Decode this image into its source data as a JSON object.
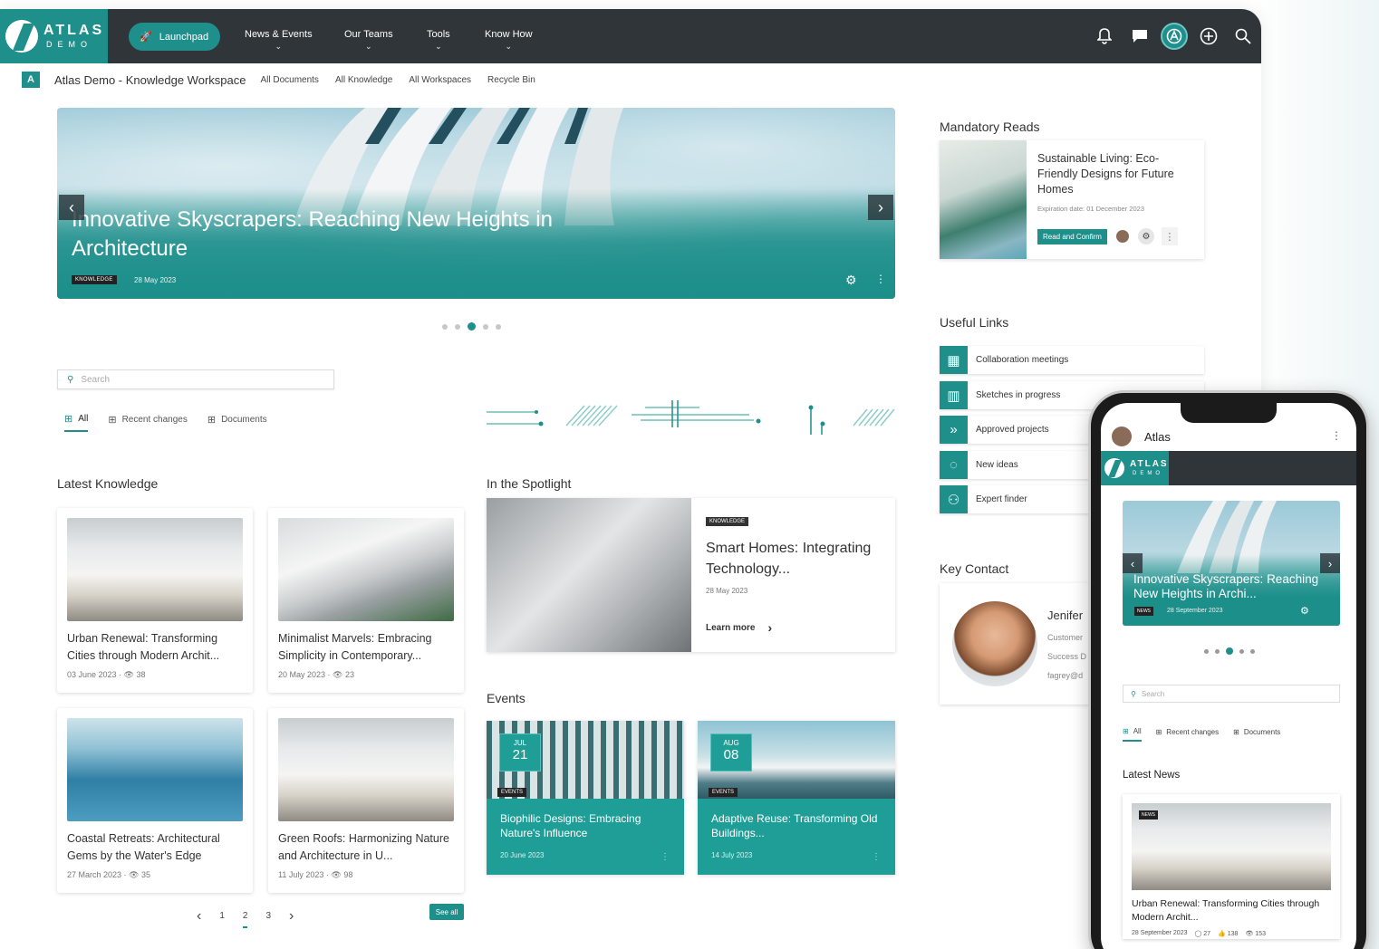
{
  "brand": {
    "name": "ATLAS",
    "sub": "DEMO",
    "accent": "#1f8f8c",
    "topbar": "#2f3538"
  },
  "nav": {
    "launchpad": "Launchpad",
    "items": [
      {
        "label": "News & Events"
      },
      {
        "label": "Our Teams"
      },
      {
        "label": "Tools"
      },
      {
        "label": "Know How"
      }
    ],
    "icons": [
      "bell-icon",
      "chat-icon",
      "atlas-app-icon",
      "add-icon",
      "search-icon"
    ]
  },
  "subnav": {
    "badge": "A",
    "site": "Atlas Demo - Knowledge Workspace",
    "links": [
      "All Documents",
      "All Knowledge",
      "All Workspaces",
      "Recycle Bin"
    ]
  },
  "hero": {
    "title": "Innovative Skyscrapers: Reaching New Heights in Architecture",
    "tag": "KNOWLEDGE",
    "date": "28 May 2023",
    "prev": "‹",
    "next": "›"
  },
  "search": {
    "placeholder": "Search"
  },
  "tabs": [
    "All",
    "Recent changes",
    "Documents"
  ],
  "latest": {
    "heading": "Latest Knowledge",
    "cards": [
      {
        "title": "Urban Renewal: Transforming Cities through Modern Archit...",
        "date": "03 June 2023",
        "views": "38"
      },
      {
        "title": "Minimalist Marvels: Embracing Simplicity in Contemporary...",
        "date": "20 May 2023",
        "views": "23"
      },
      {
        "title": "Coastal Retreats: Architectural Gems by the Water's Edge",
        "date": "27 March 2023",
        "views": "35"
      },
      {
        "title": "Green Roofs: Harmonizing Nature and Architecture in U...",
        "date": "11 July 2023",
        "views": "98"
      }
    ]
  },
  "spotlight": {
    "heading": "In the Spotlight",
    "tag": "KNOWLEDGE",
    "title": "Smart Homes: Integrating Technology...",
    "date": "28 May 2023",
    "more": "Learn more"
  },
  "events": {
    "heading": "Events",
    "items": [
      {
        "month": "JUL",
        "day": "21",
        "tag": "EVENTS",
        "title": "Biophilic Designs: Embracing Nature's Influence",
        "date": "20 June 2023"
      },
      {
        "month": "AUG",
        "day": "08",
        "tag": "EVENTS",
        "title": "Adaptive Reuse: Transforming Old Buildings...",
        "date": "14 July 2023"
      }
    ]
  },
  "pager": {
    "prev": "‹",
    "pages": [
      "1",
      "2",
      "3"
    ],
    "current": "2",
    "next": "›",
    "see_all": "See all"
  },
  "mandatory": {
    "heading": "Mandatory Reads",
    "title": "Sustainable Living: Eco-Friendly Designs for Future Homes",
    "expiry": "Expiration date: 01 December 2023",
    "button": "Read and Confirm"
  },
  "useful": {
    "heading": "Useful Links",
    "links": [
      {
        "label": "Collaboration meetings",
        "icon": "calendar-icon"
      },
      {
        "label": "Sketches in progress",
        "icon": "books-icon"
      },
      {
        "label": "Approved projects",
        "icon": "forward-calendar-icon"
      },
      {
        "label": "New ideas",
        "icon": "lightbulb-icon"
      },
      {
        "label": "Expert finder",
        "icon": "people-search-icon"
      }
    ]
  },
  "contact": {
    "heading": "Key Contact",
    "name": "Jenifer",
    "line1": "Customer",
    "line2": "Success D",
    "line3": "fagrey@d"
  },
  "phone": {
    "user": "Atlas",
    "hero_title": "Innovative Skyscrapers: Reaching New Heights in Archi...",
    "hero_tag": "NEWS",
    "hero_date": "28 September 2023",
    "search": "Search",
    "tabs": [
      "All",
      "Recent changes",
      "Documents"
    ],
    "section": "Latest News",
    "card_tag": "NEWS",
    "card_title": "Urban Renewal: Transforming Cities through Modern Archit...",
    "card_date": "28 September 2023",
    "comments": "27",
    "likes": "138",
    "views": "153"
  }
}
